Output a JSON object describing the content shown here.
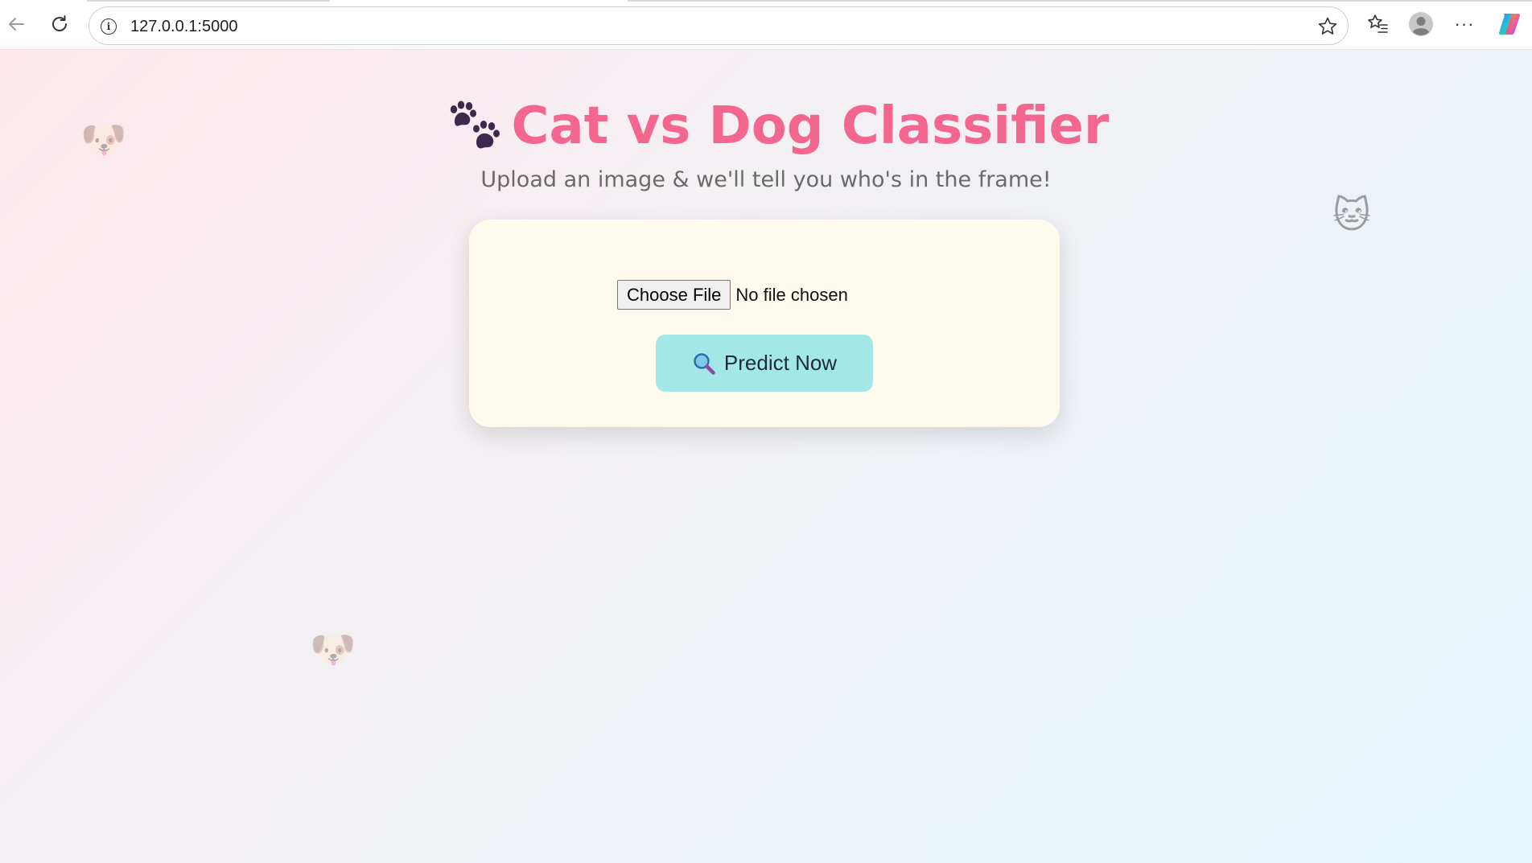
{
  "browser": {
    "url": "127.0.0.1:5000",
    "more_label": "···"
  },
  "decor": {
    "dog_emoji": "🐶",
    "cat_emoji": "🐱"
  },
  "header": {
    "title": "Cat vs Dog Classifier",
    "subtitle": "Upload an image & we'll tell you who's in the frame!"
  },
  "form": {
    "choose_file_label": "Choose File",
    "file_status": "No file chosen",
    "predict_label": "Predict Now"
  },
  "colors": {
    "accent": "#f2668f",
    "card": "#fff9ee",
    "button": "#a3e8e6"
  }
}
